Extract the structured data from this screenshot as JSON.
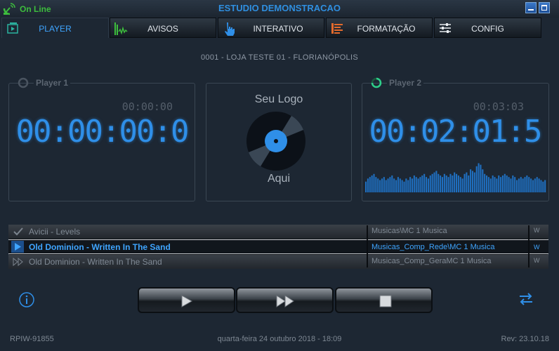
{
  "window": {
    "status": "On Line",
    "title": "ESTUDIO DEMONSTRACAO"
  },
  "tabs": [
    {
      "label": "PLAYER",
      "icon": "player-icon",
      "active": true
    },
    {
      "label": "AVISOS",
      "icon": "audio-wave-icon"
    },
    {
      "label": "INTERATIVO",
      "icon": "hand-pointer-icon"
    },
    {
      "label": "FORMATAÇÃO",
      "icon": "list-lines-icon"
    },
    {
      "label": "CONFIG",
      "icon": "sliders-icon"
    }
  ],
  "store": "0001 - LOJA TESTE 01 - FLORIANÓPOLIS",
  "player1": {
    "title": "Player 1",
    "total": "00:00:00",
    "elapsed": "00:00:00:0"
  },
  "logo": {
    "top_text": "Seu Logo",
    "bottom_text": "Aqui"
  },
  "player2": {
    "title": "Player 2",
    "total": "00:03:03",
    "elapsed": "00:02:01:5",
    "spectrum_levels": [
      0.35,
      0.45,
      0.5,
      0.55,
      0.6,
      0.5,
      0.45,
      0.4,
      0.45,
      0.5,
      0.4,
      0.45,
      0.5,
      0.55,
      0.45,
      0.4,
      0.5,
      0.45,
      0.4,
      0.35,
      0.45,
      0.4,
      0.5,
      0.45,
      0.55,
      0.5,
      0.45,
      0.5,
      0.55,
      0.6,
      0.5,
      0.45,
      0.55,
      0.6,
      0.65,
      0.7,
      0.6,
      0.55,
      0.5,
      0.6,
      0.55,
      0.5,
      0.6,
      0.55,
      0.65,
      0.6,
      0.55,
      0.5,
      0.45,
      0.6,
      0.65,
      0.55,
      0.75,
      0.7,
      0.65,
      0.85,
      0.95,
      0.9,
      0.75,
      0.6,
      0.55,
      0.5,
      0.45,
      0.55,
      0.5,
      0.45,
      0.55,
      0.5,
      0.55,
      0.6,
      0.55,
      0.5,
      0.45,
      0.55,
      0.5,
      0.4,
      0.45,
      0.5,
      0.45,
      0.5,
      0.55,
      0.5,
      0.45,
      0.4,
      0.45,
      0.5,
      0.45,
      0.4,
      0.35,
      0.4
    ]
  },
  "playlist": [
    {
      "state": "played",
      "name": "Avicii - Levels",
      "path": "Musicas\\MC 1 Musica",
      "flag": "W"
    },
    {
      "state": "playing",
      "name": "Old Dominion - Written In The Sand",
      "path": "Musicas_Comp_Rede\\MC 1 Musica",
      "flag": "W"
    },
    {
      "state": "next",
      "name": "Old Dominion - Written In The Sand",
      "path": "Musicas_Comp_GeraMC 1 Musica",
      "flag": "W"
    }
  ],
  "controls": [
    "play-icon",
    "fast-forward-icon",
    "stop-icon"
  ],
  "footer": {
    "id": "RPIW-91855",
    "datetime": "quarta-feira 24 outubro 2018 - 18:09",
    "rev": "Rev: 23.10.18"
  },
  "colors": {
    "accent": "#2f8fe8",
    "online": "#3dbd3d",
    "background": "#1d2733"
  }
}
